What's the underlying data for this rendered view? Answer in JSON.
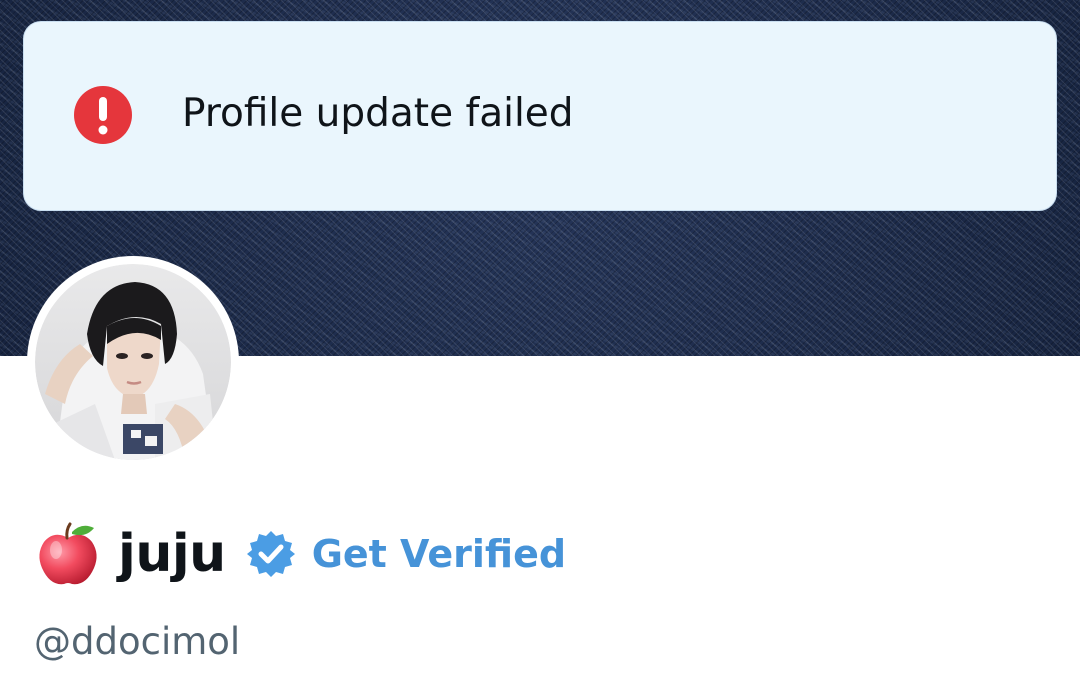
{
  "toast": {
    "message": "Profile update failed",
    "icon": "error-exclamation-icon",
    "icon_color": "#e0245e",
    "background": "#eaf6fd"
  },
  "banner": {
    "description_icon": "denim-texture"
  },
  "profile": {
    "emoji_icon": "apple-emoji-icon",
    "display_name": "juju",
    "verified_icon": "verified-badge-icon",
    "verified_color": "#4b9de4",
    "get_verified_label": "Get Verified",
    "handle": "@ddocimol"
  },
  "colors": {
    "text_primary": "#0f1419",
    "text_secondary": "#536471",
    "link_blue": "#4693d8"
  }
}
